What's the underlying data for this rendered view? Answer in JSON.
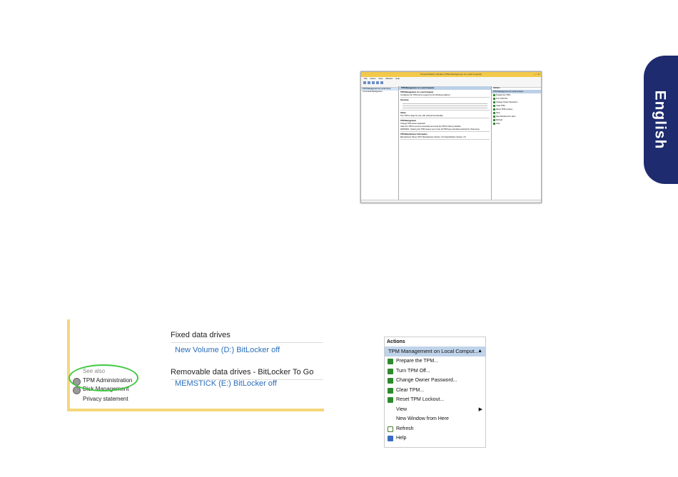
{
  "side_tab": {
    "label": "English"
  },
  "tpm_window": {
    "title": "Trusted Platform Module (TPM) Management on Local Computer",
    "menu": [
      "File",
      "Action",
      "View",
      "Window",
      "Help"
    ],
    "tree": [
      "TPM Management on Local Comp",
      "Command Management"
    ],
    "main_header": "TPM Management on Local Computer",
    "main_intro_1": "TPM Management on Local Computer",
    "main_intro_2": "Configures the TPM and its support by the Windows platform",
    "overview_title": "Overview",
    "status_title": "Status",
    "status_text": "The TPM is ready for use, with reduced functionality.",
    "management_title": "TPM Management",
    "management_items": [
      "Change TPM owner password",
      "Clear the TPM to remove ownership and reset the TPM to factory defaults"
    ],
    "warning": "WARNING: Clearing the TPM causes you to lose all TPM keys and data protected by those keys.",
    "manufacturer_title": "TPM Manufacturer Information",
    "manufacturer_name": "Manufacturer Name: INTC",
    "manufacturer_version": "Manufacturer Version: 11.5",
    "spec_version": "Specification Version: 2.0",
    "actions_title": "Actions",
    "actions_sub": "TPM Management on Local Comput...",
    "actions": [
      "Prepare the TPM...",
      "Turn TPM Off...",
      "Change Owner Password...",
      "Clear TPM...",
      "Reset TPM Lockout...",
      "View",
      "New Window from Here",
      "Refresh",
      "Help"
    ]
  },
  "control_panel": {
    "fixed_drives": "Fixed data drives",
    "volume": "New Volume (D:) BitLocker off",
    "removable_drives": "Removable data drives - BitLocker To Go",
    "memstick": "MEMSTICK (E:) BitLocker off",
    "see_also": "See also",
    "tpm_admin": "TPM Administration",
    "disk_mgmt": "Disk Management",
    "privacy": "Privacy statement"
  },
  "actions_panel": {
    "title": "Actions",
    "subheader": "TPM Management on Local Comput...",
    "items": {
      "prepare": "Prepare the TPM...",
      "turn_off": "Turn TPM Off...",
      "change_pw": "Change Owner Password...",
      "clear": "Clear TPM...",
      "reset": "Reset TPM Lockout...",
      "view": "View",
      "new_window": "New Window from Here",
      "refresh": "Refresh",
      "help": "Help"
    }
  }
}
